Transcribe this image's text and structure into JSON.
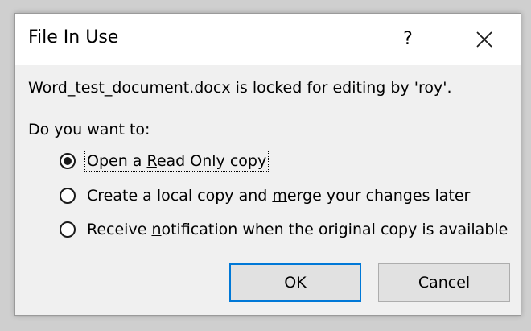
{
  "dialog": {
    "title": "File In Use",
    "help_label": "?",
    "message": "Word_test_document.docx is locked for editing by 'roy'.",
    "prompt": "Do you want to:",
    "options": [
      {
        "pre": "Open a ",
        "key": "R",
        "post": "ead Only copy",
        "selected": true
      },
      {
        "pre": "Create a local copy and ",
        "key": "m",
        "post": "erge your changes later",
        "selected": false
      },
      {
        "pre": "Receive ",
        "key": "n",
        "post": "otification when the original copy is available",
        "selected": false
      }
    ],
    "ok_label": "OK",
    "cancel_label": "Cancel"
  },
  "colors": {
    "accent": "#0078d7",
    "dialog_bg": "#f0f0f0",
    "titlebar_bg": "#ffffff"
  }
}
